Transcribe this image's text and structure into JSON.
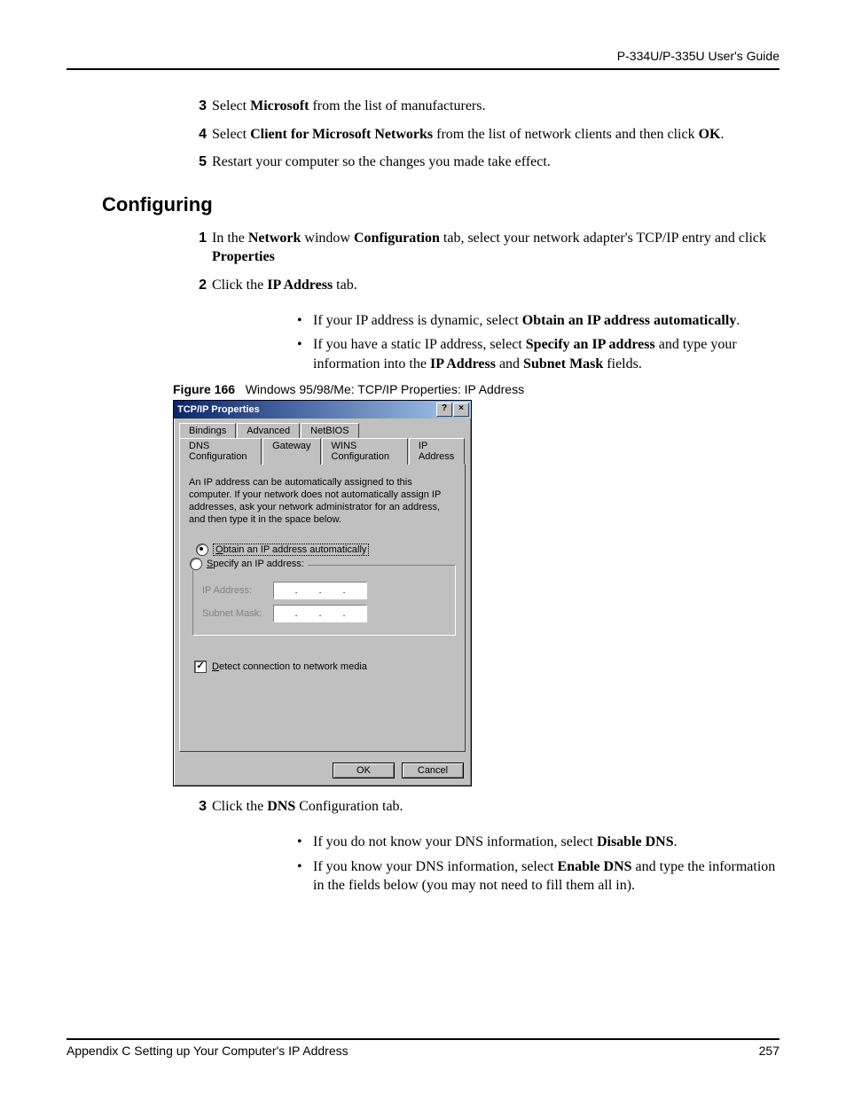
{
  "header": {
    "guide_title": "P-334U/P-335U User's Guide"
  },
  "first_steps": [
    {
      "n": "3",
      "pre": "Select ",
      "bold1": "Microsoft",
      "post": " from the list of manufacturers."
    },
    {
      "n": "4",
      "pre": "Select ",
      "bold1": "Client for Microsoft Networks",
      "mid": " from the list of network clients and then click ",
      "bold2": "OK",
      "post": "."
    },
    {
      "n": "5",
      "pre": "Restart your computer so the changes you made take effect.",
      "bold1": "",
      "post": ""
    }
  ],
  "section_title": "Configuring",
  "config_steps": {
    "s1": {
      "n": "1",
      "pre": "In the ",
      "b1": "Network",
      "mid1": " window ",
      "b2": "Configuration",
      "mid2": " tab, select your network adapter's TCP/IP entry and click ",
      "b3": "Properties",
      "post": ""
    },
    "s2": {
      "n": "2",
      "pre": "Click the ",
      "b1": "IP Address",
      "post": " tab."
    },
    "bul1": {
      "pre": "If your IP address is dynamic, select ",
      "b1": "Obtain an IP address automatically",
      "post": "."
    },
    "bul2": {
      "pre": "If you have a static IP address, select ",
      "b1": "Specify an IP address",
      "mid": " and type your information into the ",
      "b2": "IP Address",
      "mid2": " and ",
      "b3": "Subnet Mask",
      "post": " fields."
    },
    "s3": {
      "n": "3",
      "pre": "Click the ",
      "b1": "DNS",
      "post": " Configuration tab."
    },
    "bul3": {
      "pre": "If you do not know your DNS information, select ",
      "b1": "Disable DNS",
      "post": "."
    },
    "bul4": {
      "pre": "If you know your DNS information, select ",
      "b1": "Enable DNS",
      "post": " and type the information in the fields below (you may not need to fill them all in)."
    }
  },
  "figure": {
    "label": "Figure 166",
    "caption": "Windows 95/98/Me: TCP/IP Properties: IP Address"
  },
  "dialog": {
    "title": "TCP/IP Properties",
    "tabs_row1": [
      "Bindings",
      "Advanced",
      "NetBIOS"
    ],
    "tabs_row2": [
      "DNS Configuration",
      "Gateway",
      "WINS Configuration",
      "IP Address"
    ],
    "active_tab": "IP Address",
    "description": "An IP address can be automatically assigned to this computer. If your network does not automatically assign IP addresses, ask your network administrator for an address, and then type it in the space below.",
    "radio_obtain": "Obtain an IP address automatically",
    "radio_specify": "Specify an IP address:",
    "ip_label": "IP Address:",
    "subnet_label": "Subnet Mask:",
    "detect_label": "Detect connection to network media",
    "ok": "OK",
    "cancel": "Cancel",
    "help_glyph": "?",
    "close_glyph": "×",
    "check_glyph": "✓"
  },
  "footer": {
    "left": "Appendix C Setting up Your Computer's IP Address",
    "right": "257"
  }
}
